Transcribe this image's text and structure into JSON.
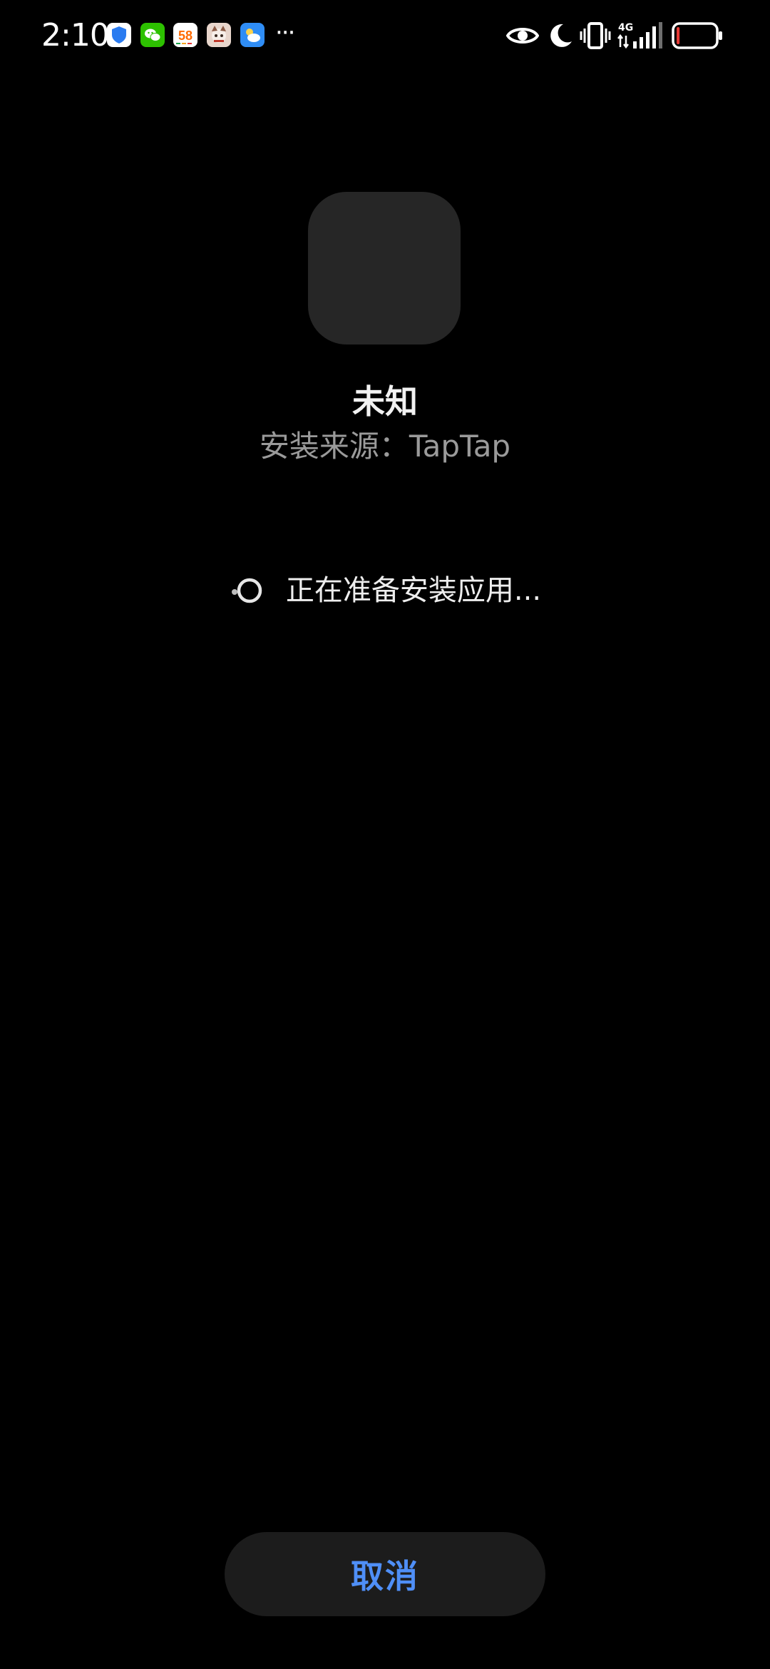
{
  "status_bar": {
    "time": "2:10",
    "notification_icons": [
      "shield-security-icon",
      "wechat-icon",
      "app-58-icon",
      "game-avatar-icon",
      "weather-icon"
    ],
    "more_indicator": "···",
    "system_icons": [
      "eye-comfort-icon",
      "do-not-disturb-moon-icon",
      "vibrate-icon",
      "signal-4g-icon",
      "battery-low-icon"
    ],
    "network_label": "4G",
    "battery_level": 0.08,
    "battery_color": "#e53935"
  },
  "app": {
    "name": "未知",
    "install_source": "安装来源：TapTap"
  },
  "progress": {
    "text": "正在准备安装应用..."
  },
  "actions": {
    "cancel_label": "取消"
  },
  "colors": {
    "background": "#000000",
    "accent": "#4f8ff7",
    "button_bg": "#1c1c1c",
    "icon_placeholder": "#262626"
  }
}
